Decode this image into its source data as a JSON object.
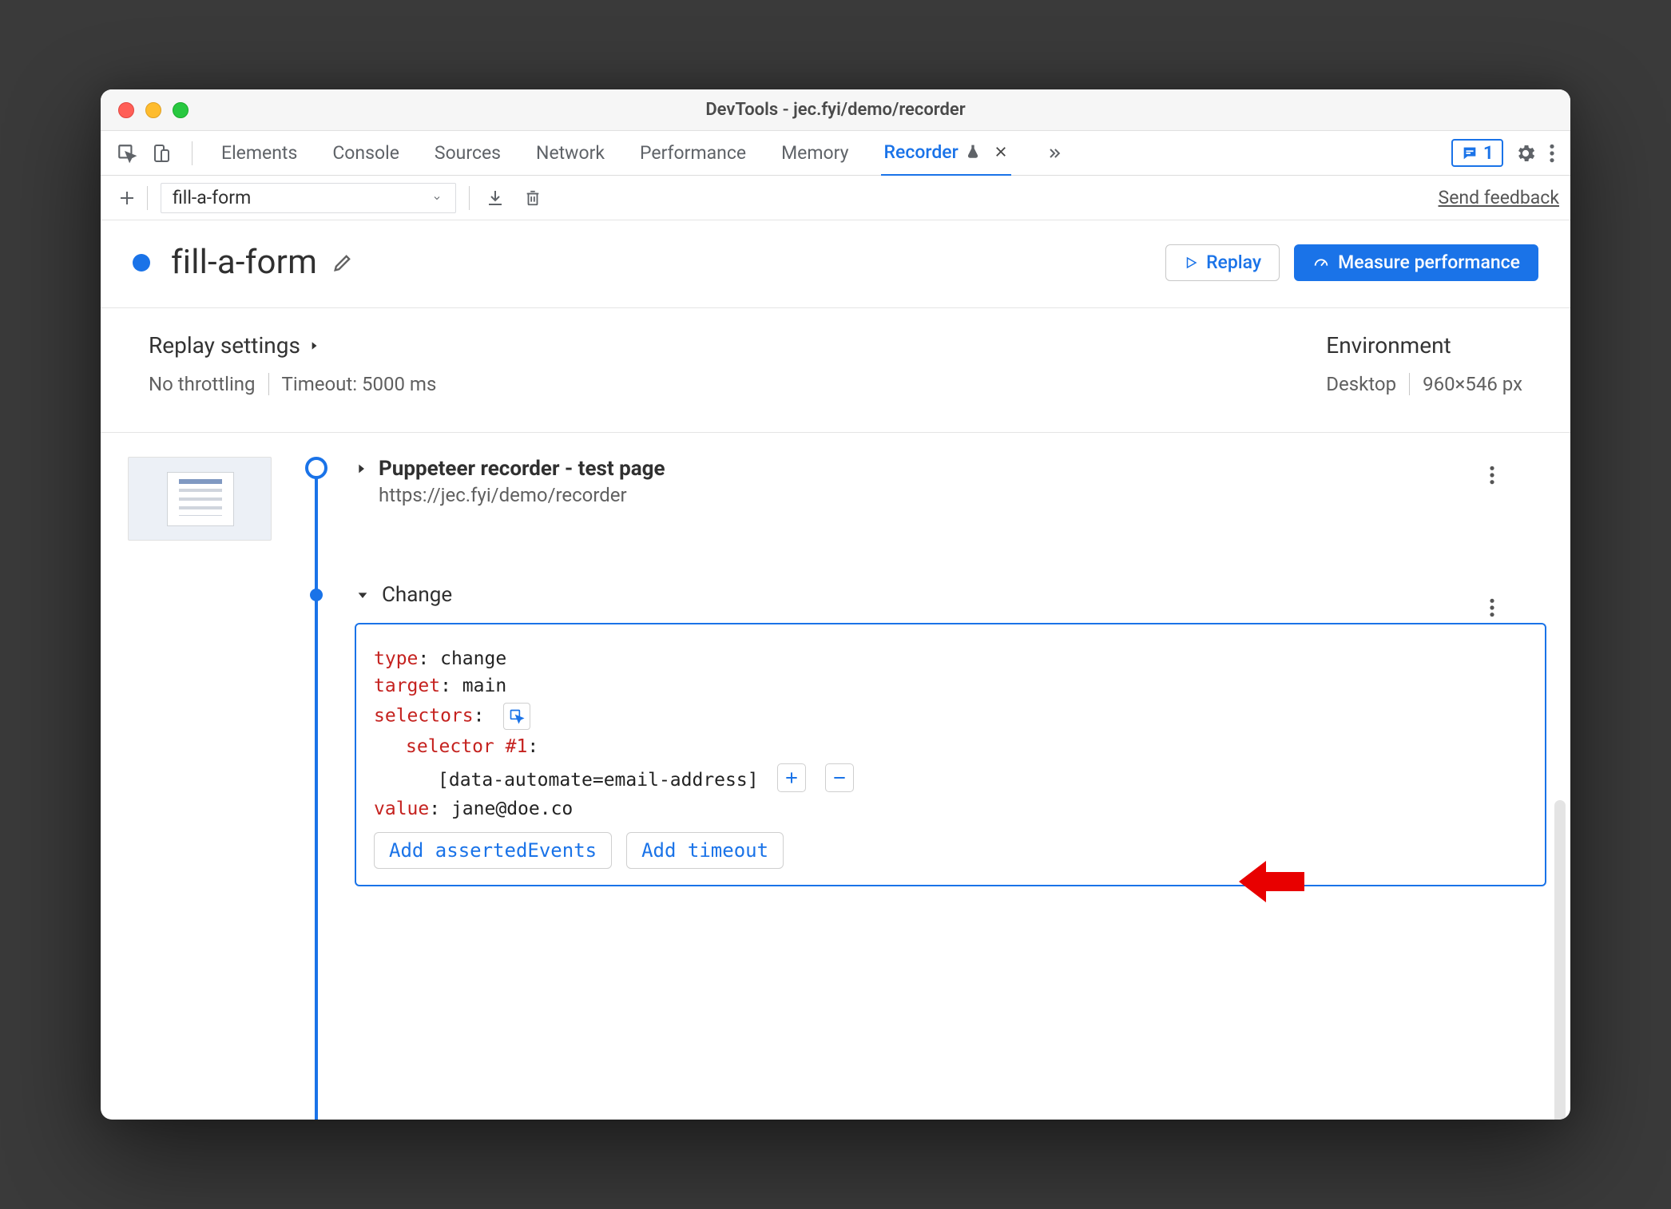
{
  "window": {
    "title": "DevTools - jec.fyi/demo/recorder"
  },
  "tabs": {
    "items": [
      "Elements",
      "Console",
      "Sources",
      "Network",
      "Performance",
      "Memory"
    ],
    "active": "Recorder",
    "msg_count": "1"
  },
  "recorder_toolbar": {
    "selected_recording": "fill-a-form",
    "feedback_link": "Send feedback"
  },
  "header": {
    "recording_name": "fill-a-form",
    "replay_label": "Replay",
    "measure_label": "Measure performance"
  },
  "settings": {
    "replay_title": "Replay settings",
    "throttling": "No throttling",
    "timeout": "Timeout: 5000 ms",
    "env_title": "Environment",
    "env_device": "Desktop",
    "env_viewport": "960×546 px"
  },
  "steps": [
    {
      "title": "Puppeteer recorder - test page",
      "url": "https://jec.fyi/demo/recorder"
    },
    {
      "title": "Change",
      "details": {
        "type_key": "type",
        "type_val": "change",
        "target_key": "target",
        "target_val": "main",
        "selectors_key": "selectors",
        "selector_label": "selector #1",
        "selector_val": "[data-automate=email-address]",
        "value_key": "value",
        "value_val": "jane@doe.co",
        "add_asserted": "Add assertedEvents",
        "add_timeout": "Add timeout"
      }
    }
  ]
}
